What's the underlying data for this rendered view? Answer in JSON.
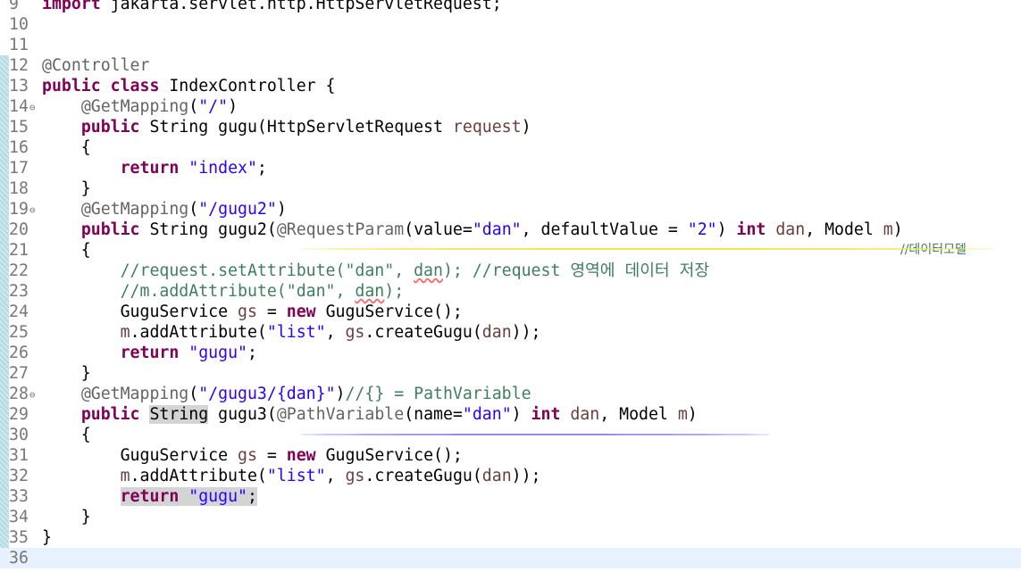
{
  "editor": {
    "lines": [
      {
        "n": "9",
        "current": false,
        "changed": false,
        "fold": false,
        "tokens": [
          {
            "t": "import",
            "c": "kw"
          },
          {
            "t": " jakarta.servlet.http.HttpServletRequest;"
          }
        ]
      },
      {
        "n": "10",
        "current": false,
        "changed": false,
        "fold": false,
        "tokens": []
      },
      {
        "n": "11",
        "current": false,
        "changed": false,
        "fold": false,
        "tokens": []
      },
      {
        "n": "12",
        "current": false,
        "changed": true,
        "fold": false,
        "tokens": [
          {
            "t": "@Controller",
            "c": "ann"
          }
        ]
      },
      {
        "n": "13",
        "current": false,
        "changed": true,
        "fold": false,
        "tokens": [
          {
            "t": "public",
            "c": "kw"
          },
          {
            "t": " "
          },
          {
            "t": "class",
            "c": "kw"
          },
          {
            "t": " IndexController {"
          }
        ]
      },
      {
        "n": "14",
        "current": false,
        "changed": true,
        "fold": true,
        "tokens": [
          {
            "t": "    "
          },
          {
            "t": "@GetMapping",
            "c": "ann"
          },
          {
            "t": "("
          },
          {
            "t": "\"/\"",
            "c": "str"
          },
          {
            "t": ")"
          }
        ]
      },
      {
        "n": "15",
        "current": false,
        "changed": true,
        "fold": false,
        "tokens": [
          {
            "t": "    "
          },
          {
            "t": "public",
            "c": "kw"
          },
          {
            "t": " String gugu(HttpServletRequest "
          },
          {
            "t": "request",
            "c": "param"
          },
          {
            "t": ")"
          }
        ]
      },
      {
        "n": "16",
        "current": false,
        "changed": true,
        "fold": false,
        "tokens": [
          {
            "t": "    {"
          }
        ]
      },
      {
        "n": "17",
        "current": false,
        "changed": true,
        "fold": false,
        "tokens": [
          {
            "t": "        "
          },
          {
            "t": "return",
            "c": "kw"
          },
          {
            "t": " "
          },
          {
            "t": "\"index\"",
            "c": "str"
          },
          {
            "t": ";"
          }
        ]
      },
      {
        "n": "18",
        "current": false,
        "changed": true,
        "fold": false,
        "tokens": [
          {
            "t": "    }"
          }
        ]
      },
      {
        "n": "19",
        "current": false,
        "changed": true,
        "fold": true,
        "tokens": [
          {
            "t": "    "
          },
          {
            "t": "@GetMapping",
            "c": "ann"
          },
          {
            "t": "("
          },
          {
            "t": "\"/gugu2\"",
            "c": "str"
          },
          {
            "t": ")"
          }
        ]
      },
      {
        "n": "20",
        "current": false,
        "changed": true,
        "fold": false,
        "tokens": [
          {
            "t": "    "
          },
          {
            "t": "public",
            "c": "kw"
          },
          {
            "t": " String gugu2("
          },
          {
            "t": "@RequestParam",
            "c": "ann"
          },
          {
            "t": "(value="
          },
          {
            "t": "\"dan\"",
            "c": "str"
          },
          {
            "t": ", defaultValue = "
          },
          {
            "t": "\"2\"",
            "c": "str"
          },
          {
            "t": ") "
          },
          {
            "t": "int",
            "c": "kw"
          },
          {
            "t": " "
          },
          {
            "t": "dan",
            "c": "param"
          },
          {
            "t": ", Model "
          },
          {
            "t": "m",
            "c": "param"
          },
          {
            "t": ")"
          }
        ]
      },
      {
        "n": "21",
        "current": false,
        "changed": true,
        "fold": false,
        "tokens": [
          {
            "t": "    {"
          }
        ],
        "right_comment": "//데이터모델"
      },
      {
        "n": "22",
        "current": false,
        "changed": true,
        "fold": false,
        "tokens": [
          {
            "t": "        "
          },
          {
            "t": "//request.setAttribute(\"dan\", ",
            "c": "cmt"
          },
          {
            "t": "dan",
            "c": "cmt squig"
          },
          {
            "t": "); //request 영역에 데이터 저장",
            "c": "cmt"
          }
        ]
      },
      {
        "n": "23",
        "current": false,
        "changed": true,
        "fold": false,
        "tokens": [
          {
            "t": "        "
          },
          {
            "t": "//m.addAttribute(\"dan\", ",
            "c": "cmt"
          },
          {
            "t": "dan",
            "c": "cmt squig"
          },
          {
            "t": ");",
            "c": "cmt"
          }
        ]
      },
      {
        "n": "24",
        "current": false,
        "changed": true,
        "fold": false,
        "tokens": [
          {
            "t": "        GuguService "
          },
          {
            "t": "gs",
            "c": "param"
          },
          {
            "t": " = "
          },
          {
            "t": "new",
            "c": "kw"
          },
          {
            "t": " GuguService();"
          }
        ]
      },
      {
        "n": "25",
        "current": false,
        "changed": true,
        "fold": false,
        "tokens": [
          {
            "t": "        "
          },
          {
            "t": "m",
            "c": "param"
          },
          {
            "t": ".addAttribute("
          },
          {
            "t": "\"list\"",
            "c": "str"
          },
          {
            "t": ", "
          },
          {
            "t": "gs",
            "c": "param"
          },
          {
            "t": ".createGugu("
          },
          {
            "t": "dan",
            "c": "param"
          },
          {
            "t": "));"
          }
        ]
      },
      {
        "n": "26",
        "current": false,
        "changed": true,
        "fold": false,
        "tokens": [
          {
            "t": "        "
          },
          {
            "t": "return",
            "c": "kw"
          },
          {
            "t": " "
          },
          {
            "t": "\"gugu\"",
            "c": "str"
          },
          {
            "t": ";"
          }
        ]
      },
      {
        "n": "27",
        "current": false,
        "changed": true,
        "fold": false,
        "tokens": [
          {
            "t": "    }"
          }
        ]
      },
      {
        "n": "28",
        "current": false,
        "changed": true,
        "fold": true,
        "tokens": [
          {
            "t": "    "
          },
          {
            "t": "@GetMapping",
            "c": "ann"
          },
          {
            "t": "("
          },
          {
            "t": "\"/gugu3/{dan}\"",
            "c": "str"
          },
          {
            "t": ")"
          },
          {
            "t": "//{} = PathVariable",
            "c": "cmt"
          }
        ]
      },
      {
        "n": "29",
        "current": false,
        "changed": true,
        "fold": false,
        "tokens": [
          {
            "t": "    "
          },
          {
            "t": "public",
            "c": "kw"
          },
          {
            "t": " "
          },
          {
            "t": "String",
            "c": "mark"
          },
          {
            "t": " gugu3("
          },
          {
            "t": "@PathVariable",
            "c": "ann"
          },
          {
            "t": "(name="
          },
          {
            "t": "\"dan\"",
            "c": "str"
          },
          {
            "t": ") "
          },
          {
            "t": "int",
            "c": "kw"
          },
          {
            "t": " "
          },
          {
            "t": "dan",
            "c": "param"
          },
          {
            "t": ", Model "
          },
          {
            "t": "m",
            "c": "param"
          },
          {
            "t": ")"
          }
        ]
      },
      {
        "n": "30",
        "current": false,
        "changed": true,
        "fold": false,
        "tokens": [
          {
            "t": "    {"
          }
        ]
      },
      {
        "n": "31",
        "current": false,
        "changed": true,
        "fold": false,
        "tokens": [
          {
            "t": "        GuguService "
          },
          {
            "t": "gs",
            "c": "param"
          },
          {
            "t": " = "
          },
          {
            "t": "new",
            "c": "kw"
          },
          {
            "t": " GuguService();"
          }
        ]
      },
      {
        "n": "32",
        "current": false,
        "changed": true,
        "fold": false,
        "tokens": [
          {
            "t": "        "
          },
          {
            "t": "m",
            "c": "param"
          },
          {
            "t": ".addAttribute("
          },
          {
            "t": "\"list\"",
            "c": "str"
          },
          {
            "t": ", "
          },
          {
            "t": "gs",
            "c": "param"
          },
          {
            "t": ".createGugu("
          },
          {
            "t": "dan",
            "c": "param"
          },
          {
            "t": "));"
          }
        ]
      },
      {
        "n": "33",
        "current": false,
        "changed": true,
        "fold": false,
        "tokens": [
          {
            "t": "        "
          },
          {
            "t": "return",
            "c": "kw mark"
          },
          {
            "t": " ",
            "c": "mark"
          },
          {
            "t": "\"gugu\"",
            "c": "str mark"
          },
          {
            "t": ";",
            "c": "mark"
          }
        ]
      },
      {
        "n": "34",
        "current": false,
        "changed": true,
        "fold": false,
        "tokens": [
          {
            "t": "    }"
          }
        ]
      },
      {
        "n": "35",
        "current": false,
        "changed": true,
        "fold": false,
        "tokens": [
          {
            "t": "}"
          }
        ]
      },
      {
        "n": "36",
        "current": true,
        "changed": false,
        "fold": false,
        "tokens": []
      }
    ]
  },
  "colors": {
    "keyword": "#7f0055",
    "string": "#2a00ff",
    "annotation": "#646464",
    "comment": "#3f7f5f",
    "current_line": "#e8f2fe",
    "change_bar": "#b4dbe2",
    "underline_yellow": "#f3e64a",
    "underline_blue": "#8f8fef"
  }
}
